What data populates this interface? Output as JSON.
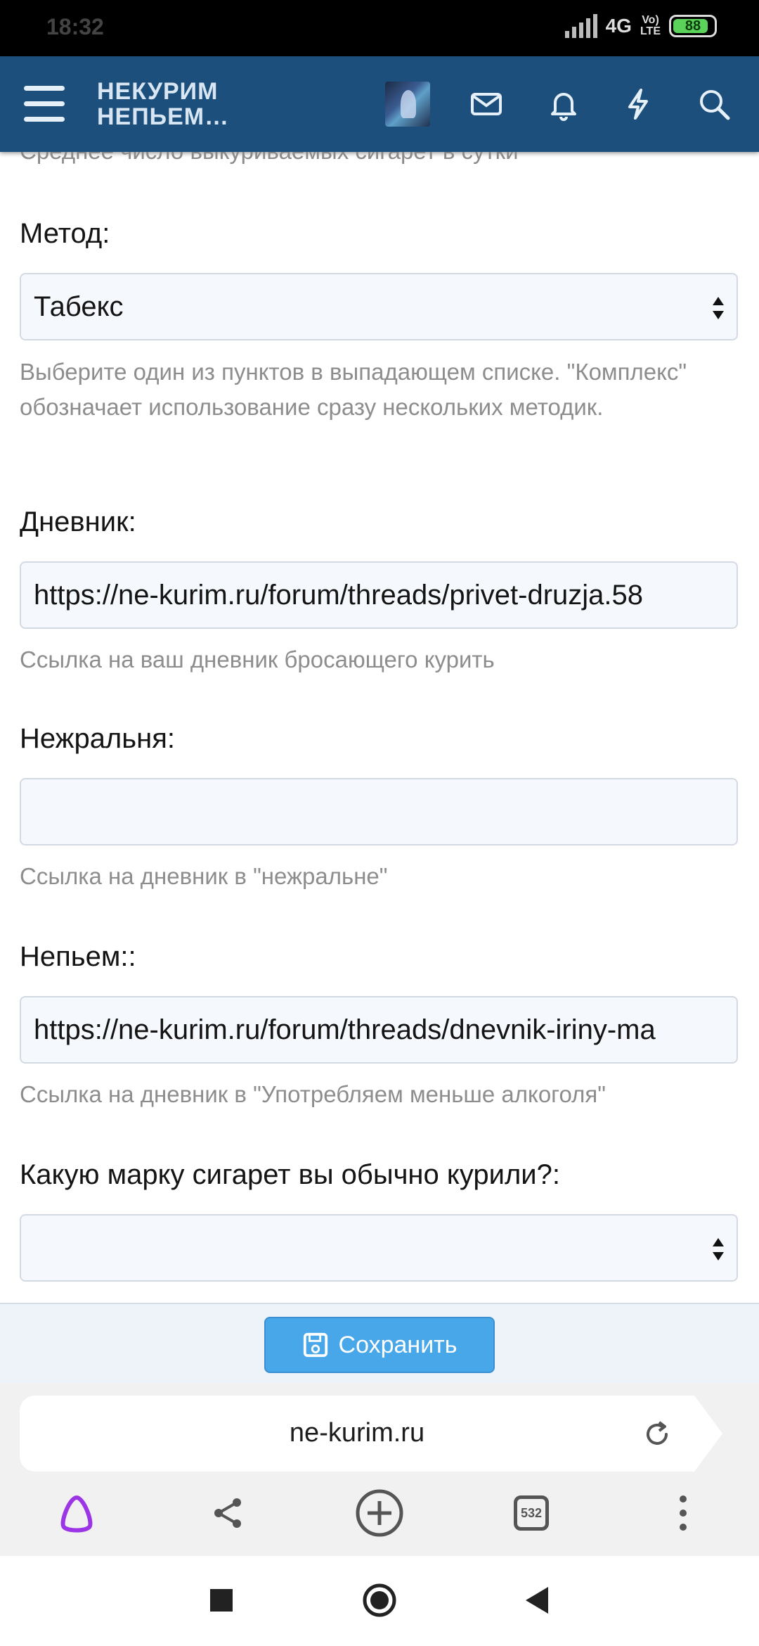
{
  "status": {
    "time": "18:32",
    "network": "4G",
    "lte_top": "Vo)",
    "lte_bottom": "LTE",
    "battery": "88",
    "battery_level": 0.88
  },
  "header": {
    "logo": "НЕКУРИМ\nНЕПЬЕМ…",
    "icons": [
      "menu-icon",
      "avatar",
      "mail-icon",
      "bell-icon",
      "bolt-icon",
      "search-icon"
    ]
  },
  "form": {
    "prev_hint": "Среднее число выкуриваемых сигарет в сутки",
    "method": {
      "label": "Метод:",
      "value": "Табекс",
      "hint": "Выберите один из пунктов в выпадающем списке. \"Комплекс\" обозначает использование сразу нескольких методик."
    },
    "diary": {
      "label": "Дневник:",
      "value": "https://ne-kurim.ru/forum/threads/privet-druzja.58",
      "hint": "Ссылка на ваш дневник бросающего курить"
    },
    "nezhralnya": {
      "label": "Нежральня:",
      "value": "",
      "hint": "Ссылка на дневник в \"нежральне\""
    },
    "nepyem": {
      "label": "Непьем::",
      "value": "https://ne-kurim.ru/forum/threads/dnevnik-iriny-ma",
      "hint": "Ссылка на дневник в \"Употребляем меньше алкоголя\""
    },
    "brand": {
      "label": "Какую марку сигарет вы обычно курили?:",
      "value": ""
    }
  },
  "save_button": {
    "label": "Сохранить"
  },
  "browser": {
    "url": "ne-kurim.ru",
    "tabs_count": "532"
  }
}
